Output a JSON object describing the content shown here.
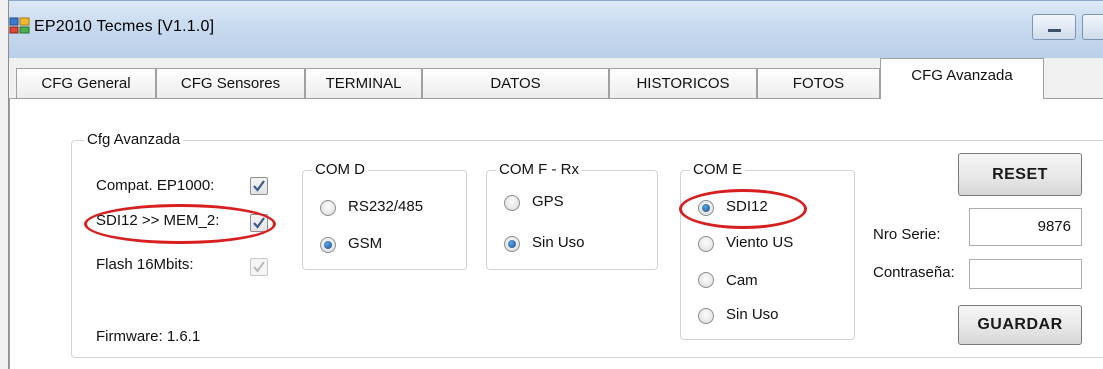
{
  "window": {
    "title": "EP2010 Tecmes  [V1.1.0]"
  },
  "tabs": [
    {
      "label": "CFG General"
    },
    {
      "label": "CFG Sensores"
    },
    {
      "label": "TERMINAL"
    },
    {
      "label": "DATOS"
    },
    {
      "label": "HISTORICOS"
    },
    {
      "label": "FOTOS"
    },
    {
      "label": "CFG Avanzada",
      "active": true
    }
  ],
  "cfg_avanzada": {
    "legend": "Cfg Avanzada",
    "compat_label": "Compat. EP1000:",
    "compat_checked": true,
    "sdi12_mem_label": "SDI12 >> MEM_2:",
    "sdi12_mem_checked": true,
    "flash_label": "Flash 16Mbits:",
    "flash_checked": true,
    "firmware_label": "Firmware: 1.6.1"
  },
  "com_d": {
    "legend": "COM D",
    "options": [
      {
        "label": "RS232/485",
        "selected": false
      },
      {
        "label": "GSM",
        "selected": true
      }
    ]
  },
  "com_f": {
    "legend": "COM F - Rx",
    "options": [
      {
        "label": "GPS",
        "selected": false
      },
      {
        "label": "Sin Uso",
        "selected": true
      }
    ]
  },
  "com_e": {
    "legend": "COM E",
    "options": [
      {
        "label": "SDI12",
        "selected": true
      },
      {
        "label": "Viento US",
        "selected": false
      },
      {
        "label": "Cam",
        "selected": false
      },
      {
        "label": "Sin  Uso",
        "selected": false
      }
    ]
  },
  "right_panel": {
    "reset_label": "RESET",
    "serial_label": "Nro Serie:",
    "serial_value": "9876",
    "password_label": "Contraseña:",
    "password_value": "",
    "save_label": "GUARDAR"
  },
  "colors": {
    "highlight_circle": "#d81f1f",
    "titlebar": "#c7d9ef",
    "radio_dot": "#1b4f8f"
  }
}
